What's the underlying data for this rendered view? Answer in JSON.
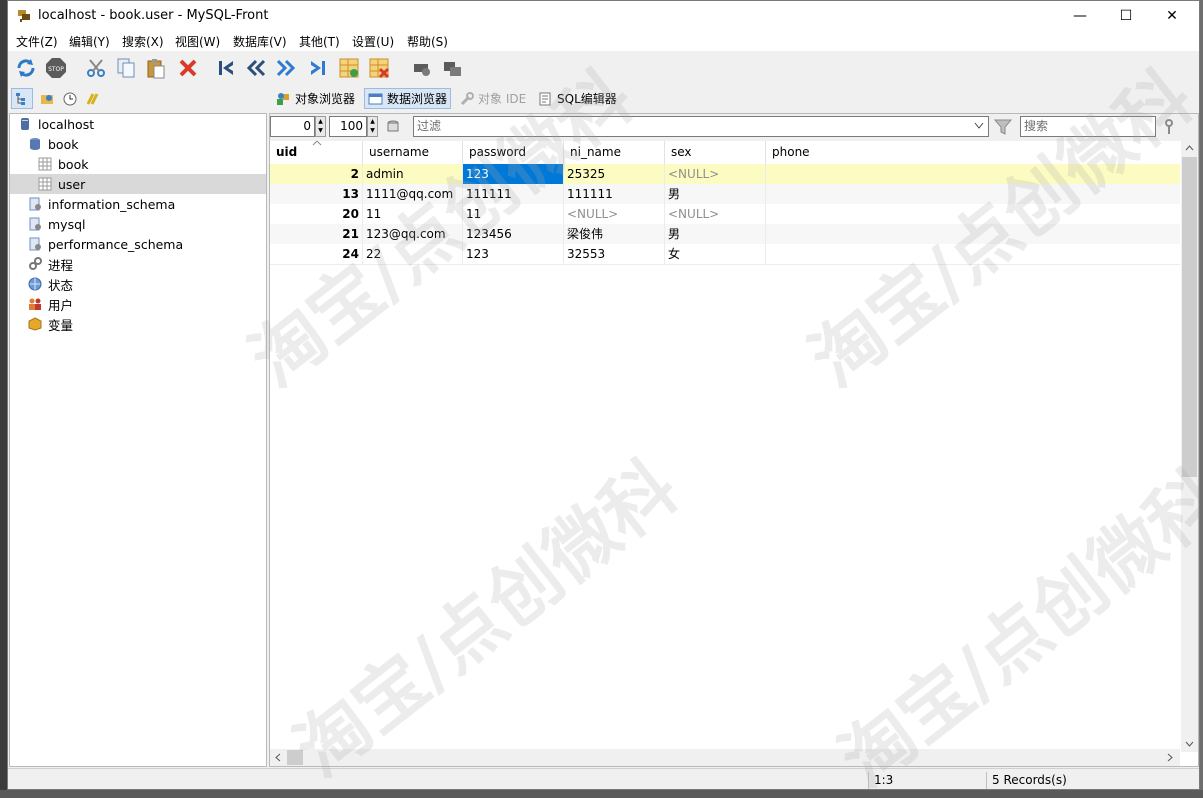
{
  "window": {
    "title": "localhost - book.user - MySQL-Front",
    "minimize": "—",
    "maximize": "☐",
    "close": "✕"
  },
  "menu": [
    "文件(Z)",
    "编辑(Y)",
    "搜索(X)",
    "视图(W)",
    "数据库(V)",
    "其他(T)",
    "设置(U)",
    "帮助(S)"
  ],
  "tabs": {
    "object_browser": "对象浏览器",
    "data_browser": "数据浏览器",
    "object_ide": "对象 IDE",
    "sql_editor": "SQL编辑器"
  },
  "tree": [
    {
      "label": "localhost",
      "icon": "server-icon"
    },
    {
      "label": "book",
      "icon": "database-icon"
    },
    {
      "label": "book",
      "icon": "table-icon"
    },
    {
      "label": "user",
      "icon": "table-icon"
    },
    {
      "label": "information_schema",
      "icon": "system-database-icon"
    },
    {
      "label": "mysql",
      "icon": "system-database-icon"
    },
    {
      "label": "performance_schema",
      "icon": "system-database-icon"
    },
    {
      "label": "进程",
      "icon": "process-icon"
    },
    {
      "label": "状态",
      "icon": "status-icon"
    },
    {
      "label": "用户",
      "icon": "users-icon"
    },
    {
      "label": "变量",
      "icon": "variables-icon"
    }
  ],
  "controls": {
    "offset": "0",
    "limit": "100",
    "filter_placeholder": "过滤",
    "search_placeholder": "搜索"
  },
  "table": {
    "columns": [
      "uid",
      "username",
      "password",
      "ni_name",
      "sex",
      "phone"
    ],
    "rows": [
      [
        "2",
        "admin",
        "123",
        "25325",
        "<NULL>",
        ""
      ],
      [
        "13",
        "1111@qq.com",
        "111111",
        "111111",
        "男",
        ""
      ],
      [
        "20",
        "11",
        "11",
        "<NULL>",
        "<NULL>",
        ""
      ],
      [
        "21",
        "123@qq.com",
        "123456",
        "梁俊伟",
        "男",
        ""
      ],
      [
        "24",
        "22",
        "123",
        "32553",
        "女",
        ""
      ]
    ]
  },
  "status": {
    "cursor": "1:3",
    "records": "5 Records(s)"
  },
  "watermark": "淘宝/点创微科",
  "colors": {
    "selected_row": "#fcfbc2",
    "selected_cell": "#0078d7",
    "null_text": "#8f8f8f"
  }
}
